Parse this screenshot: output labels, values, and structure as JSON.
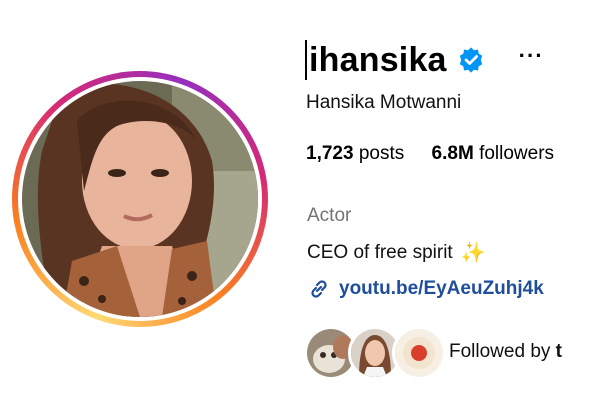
{
  "profile": {
    "username": "ihansika",
    "verified": true,
    "full_name": "Hansika Motwanni",
    "stats": [
      {
        "value": "1,723",
        "label": "posts"
      },
      {
        "value": "6.8M",
        "label": "followers"
      }
    ],
    "category": "Actor",
    "bio": "CEO of free spirit",
    "bio_emoji": "✨",
    "link": "youtu.be/EyAeuZuhj4k",
    "followed_by_prefix": "Followed by",
    "followed_by_name": "t"
  },
  "icons": {
    "verified": "verified-badge-icon",
    "more": "more-options-icon",
    "link": "link-icon"
  },
  "colors": {
    "verified_blue": "#0095f6",
    "link_blue": "#1f4e9c",
    "category_gray": "#737373"
  },
  "more_glyph": "···"
}
